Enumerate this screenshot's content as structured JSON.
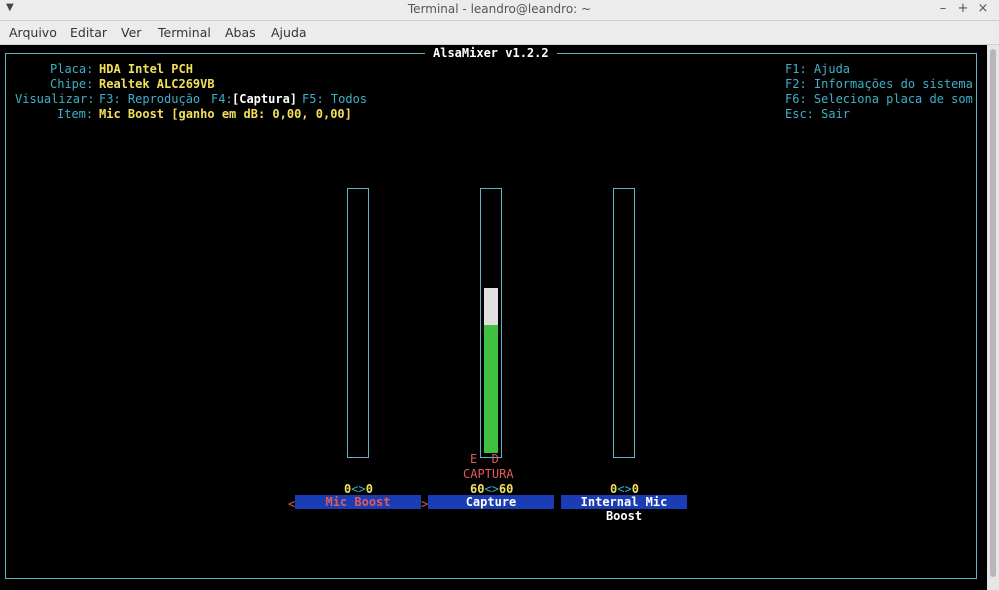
{
  "window": {
    "title": "Terminal - leandro@leandro: ~",
    "wm_menu_glyph": "▼",
    "controls": [
      "–",
      "+",
      "×"
    ]
  },
  "menu": [
    "Arquivo",
    "Editar",
    "Ver",
    "Terminal",
    "Abas",
    "Ajuda"
  ],
  "alsamixer": {
    "title": "AlsaMixer v1.2.2",
    "info": {
      "placa_label": "Placa:",
      "placa_value": "HDA Intel PCH",
      "chipe_label": "Chipe:",
      "chipe_value": "Realtek ALC269VB",
      "visualizar_label": "Visualizar:",
      "view_f3": "F3: Reprodução",
      "view_f4_key": "F4:",
      "view_f4_value": "[Captura]",
      "view_f5": "F5: Todos",
      "item_label": "Item:",
      "item_value": "Mic Boost [ganho em dB: 0,00, 0,00]"
    },
    "help": [
      "F1: Ajuda",
      "F2: Informações do sistema",
      "F6: Seleciona placa de som",
      "Esc: Sair"
    ],
    "controls": [
      {
        "name": "Mic Boost",
        "left": "0",
        "right": "0",
        "sep": "<>",
        "level": 0,
        "selected": true,
        "sel_left": "<",
        "sel_right": ">"
      },
      {
        "name": "Capture",
        "left": "60",
        "right": "60",
        "sep": "<>",
        "level": 0.63,
        "capture_top": 0.5,
        "channels": "E  D",
        "capture_label": "CAPTURA"
      },
      {
        "name": "Internal Mic Boost",
        "left": "0",
        "right": "0",
        "sep": "<>",
        "level": 0
      }
    ],
    "colors": {
      "cyan": "#3fb0c8",
      "yellow": "#f1e05a",
      "green": "#40c040",
      "blue": "#1a3cb5",
      "red": "#e35a5a"
    }
  }
}
